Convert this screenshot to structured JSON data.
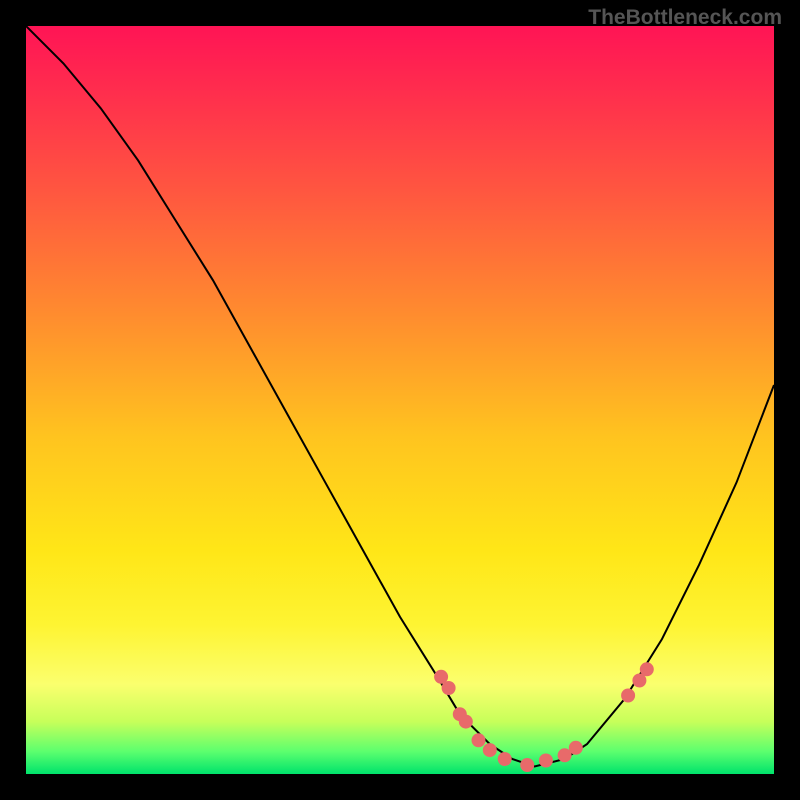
{
  "watermark": "TheBottleneck.com",
  "chart_data": {
    "type": "line",
    "title": "",
    "xlabel": "",
    "ylabel": "",
    "x_range": [
      0,
      100
    ],
    "y_range": [
      0,
      100
    ],
    "curve": {
      "name": "bottleneck-curve",
      "x": [
        0,
        5,
        10,
        15,
        20,
        25,
        30,
        35,
        40,
        45,
        50,
        55,
        58,
        62,
        65,
        68,
        72,
        75,
        80,
        85,
        90,
        95,
        100
      ],
      "y": [
        100,
        95,
        89,
        82,
        74,
        66,
        57,
        48,
        39,
        30,
        21,
        13,
        8,
        4,
        2,
        1,
        2,
        4,
        10,
        18,
        28,
        39,
        52
      ]
    },
    "marker_points": {
      "name": "sample-dots",
      "x": [
        55.5,
        56.5,
        58.0,
        58.8,
        60.5,
        62.0,
        64.0,
        67.0,
        69.5,
        72.0,
        73.5,
        80.5,
        82.0,
        83.0
      ],
      "y": [
        13.0,
        11.5,
        8.0,
        7.0,
        4.5,
        3.2,
        2.0,
        1.2,
        1.8,
        2.5,
        3.5,
        10.5,
        12.5,
        14.0
      ]
    },
    "colors": {
      "curve": "#000000",
      "dots": "#e86a6a",
      "gradient_top": "#ff1455",
      "gradient_bottom": "#00e36c"
    }
  }
}
